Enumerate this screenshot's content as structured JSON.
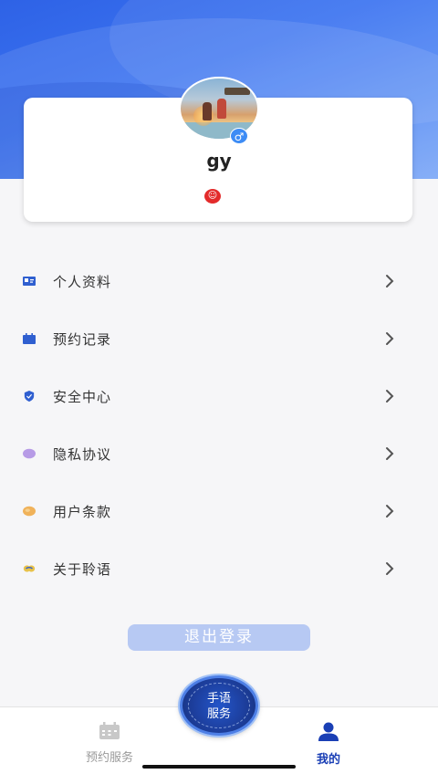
{
  "profile": {
    "username": "gy",
    "gender_symbol": "♂",
    "badge_symbol": "☺"
  },
  "menu": {
    "items": [
      {
        "label": "个人资料",
        "icon": "id-card-icon",
        "color": "#2f5fd0"
      },
      {
        "label": "预约记录",
        "icon": "calendar-icon",
        "color": "#2f5fd0"
      },
      {
        "label": "安全中心",
        "icon": "shield-icon",
        "color": "#2f5fd0"
      },
      {
        "label": "隐私协议",
        "icon": "privacy-icon",
        "color": "#b79be6"
      },
      {
        "label": "用户条款",
        "icon": "terms-icon",
        "color": "#f0b25a"
      },
      {
        "label": "关于聆语",
        "icon": "about-icon",
        "color": "#e8c24a"
      }
    ],
    "chevron": "›"
  },
  "logout_label": "退出登录",
  "center_button": {
    "line1": "手语",
    "line2": "服务"
  },
  "tabbar": {
    "booking_label": "预约服务",
    "mine_label": "我的"
  },
  "colors": {
    "primary": "#2e62e6",
    "tab_active": "#1a3fb5",
    "logout_bg": "#b7c9f3"
  }
}
